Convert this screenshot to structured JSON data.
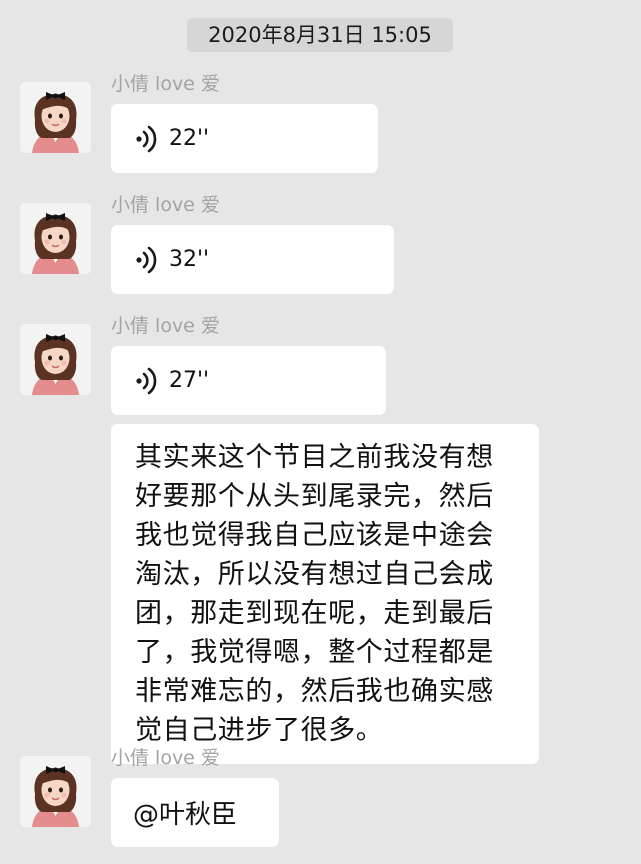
{
  "timestamp": "2020年8月31日 15:05",
  "sender_name": "小倩 love 爱",
  "voice_messages": [
    {
      "duration": "22''"
    },
    {
      "duration": "32''"
    },
    {
      "duration": "27''"
    }
  ],
  "text_message": {
    "lines": [
      "其实来这个节目之前我没有想",
      "好要那个从头到尾录完，然后",
      "我也觉得我自己应该是中途会",
      "淘汰，所以没有想过自己会成",
      "团，那走到现在呢，走到最后",
      "了，我觉得嗯，整个过程都是",
      "非常难忘的，然后我也确实感",
      "觉自己进步了很多。"
    ]
  },
  "mention_message": "@叶秋臣",
  "icons": {
    "voice": "voice-wave-icon",
    "avatar": "cartoon-girl-avatar"
  },
  "colors": {
    "background": "#e6e6e6",
    "bubble": "#ffffff",
    "timestamp_bg": "#d6d6d6",
    "sender_text": "#a3a3a3"
  }
}
